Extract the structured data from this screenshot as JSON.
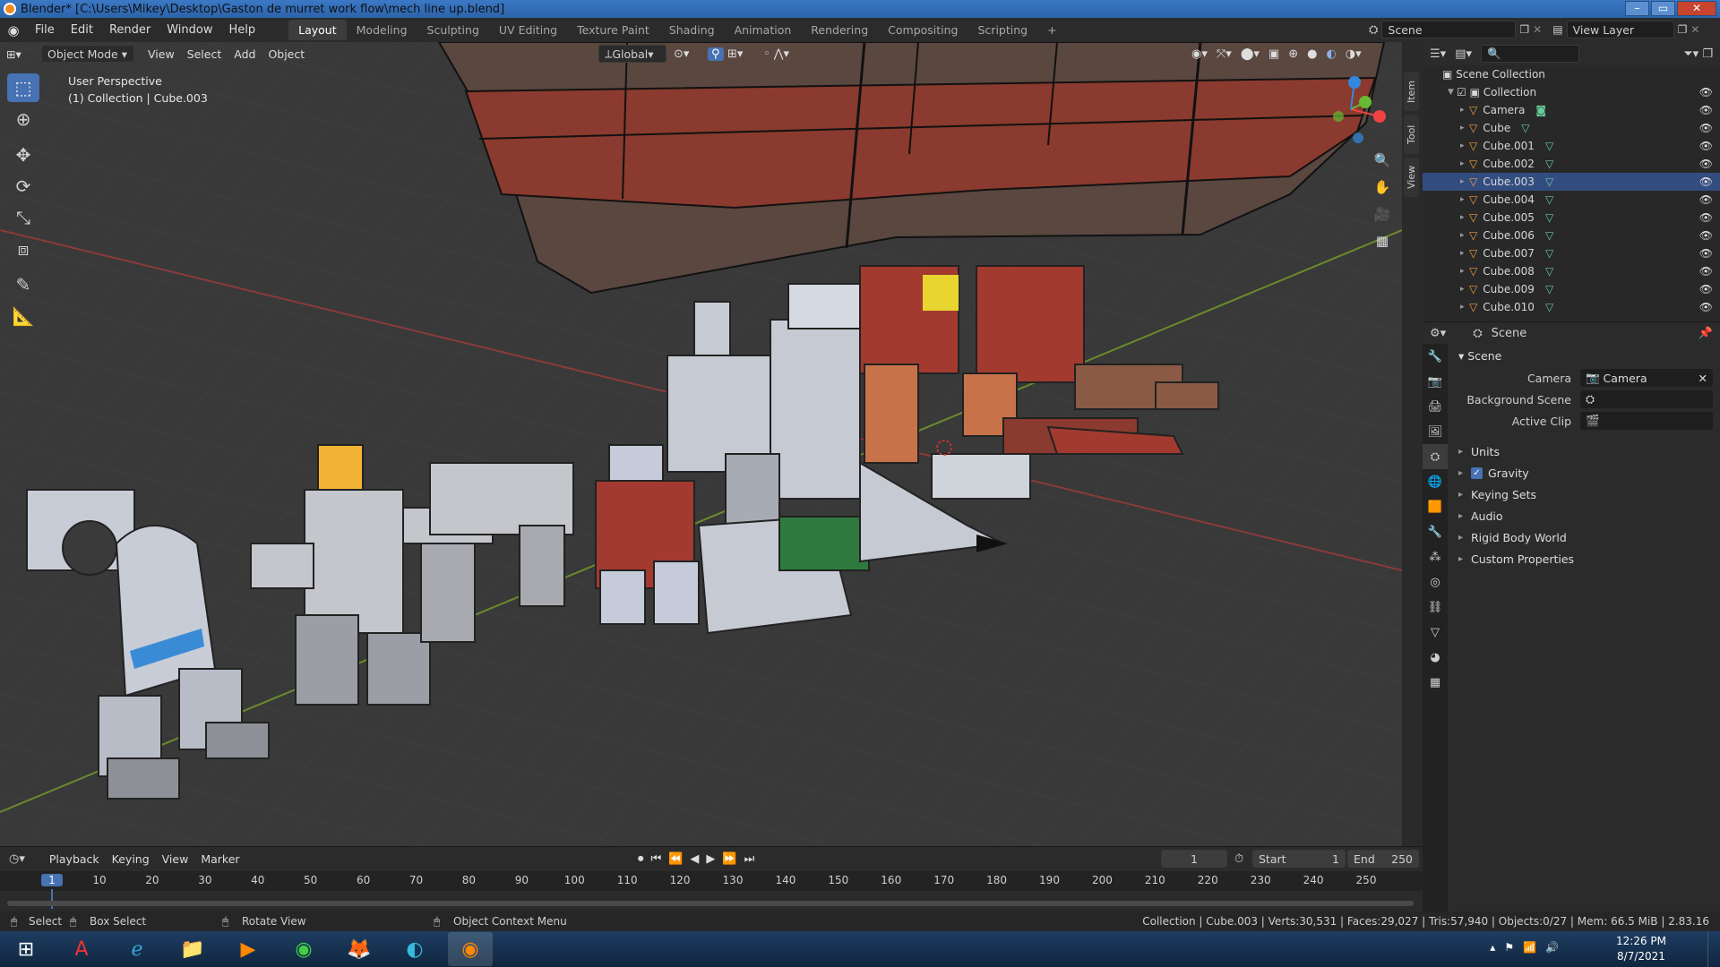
{
  "window": {
    "title": "Blender* [C:\\Users\\Mikey\\Desktop\\Gaston de murret work flow\\mech line up.blend]",
    "minimize": "–",
    "maximize": "▭",
    "close": "✕"
  },
  "menu": [
    "File",
    "Edit",
    "Render",
    "Window",
    "Help"
  ],
  "workspaces": [
    "Layout",
    "Modeling",
    "Sculpting",
    "UV Editing",
    "Texture Paint",
    "Shading",
    "Animation",
    "Rendering",
    "Compositing",
    "Scripting"
  ],
  "workspace_add": "+",
  "scene": {
    "label": "Scene",
    "view_layer": "View Layer"
  },
  "viewport": {
    "mode": "Object Mode",
    "header_menus": [
      "View",
      "Select",
      "Add",
      "Object"
    ],
    "orientation": "Global",
    "perspective": "User Perspective",
    "collection_info": "(1) Collection | Cube.003",
    "side_tabs": [
      "Item",
      "Tool",
      "View"
    ],
    "gizmo_axes": {
      "x": "X",
      "y": "Y",
      "z": "Z"
    }
  },
  "outliner": {
    "root": "Scene Collection",
    "collection": "Collection",
    "items": [
      "Camera",
      "Cube",
      "Cube.001",
      "Cube.002",
      "Cube.003",
      "Cube.004",
      "Cube.005",
      "Cube.006",
      "Cube.007",
      "Cube.008",
      "Cube.009",
      "Cube.010"
    ],
    "selected": "Cube.003"
  },
  "properties": {
    "context": "Scene",
    "section": "Scene",
    "camera_label": "Camera",
    "camera_value": "Camera",
    "background_scene_label": "Background Scene",
    "active_clip_label": "Active Clip",
    "panels": [
      "Units",
      "Gravity",
      "Keying Sets",
      "Audio",
      "Rigid Body World",
      "Custom Properties"
    ],
    "gravity_checked": true
  },
  "timeline": {
    "menus": [
      "Playback",
      "Keying",
      "View",
      "Marker"
    ],
    "current_frame": "1",
    "start_label": "Start",
    "start": "1",
    "end_label": "End",
    "end": "250",
    "ticks": [
      "1",
      "10",
      "20",
      "30",
      "40",
      "50",
      "60",
      "70",
      "80",
      "90",
      "100",
      "110",
      "120",
      "130",
      "140",
      "150",
      "160",
      "170",
      "180",
      "190",
      "200",
      "210",
      "220",
      "230",
      "240",
      "250"
    ]
  },
  "status": {
    "select": "Select",
    "box_select": "Box Select",
    "rotate": "Rotate View",
    "context_menu": "Object Context Menu",
    "stats": "Collection | Cube.003 | Verts:30,531 | Faces:29,027 | Tris:57,940 | Objects:0/27 | Mem: 66.5 MiB | 2.83.16"
  },
  "taskbar": {
    "time": "12:26 PM",
    "date": "8/7/2021"
  },
  "colors": {
    "accent": "#4772b3",
    "header": "#2b2b2b",
    "viewport": "#393939",
    "taskbar": "#173352"
  }
}
